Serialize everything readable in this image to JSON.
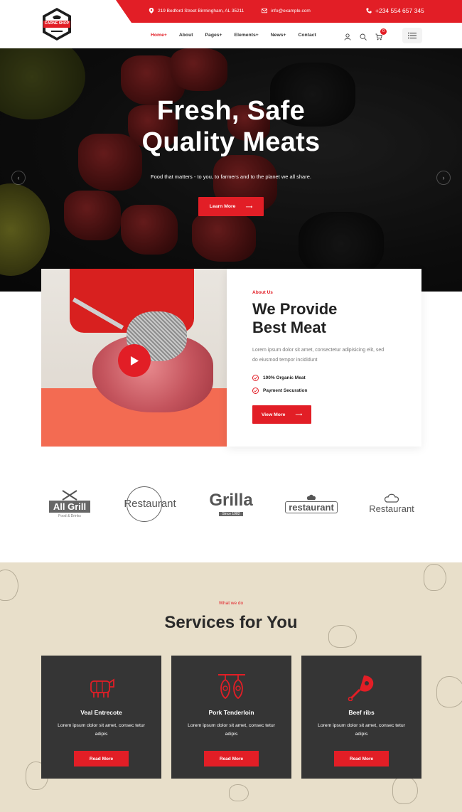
{
  "brand": {
    "logo_text": "CARNE SHOP",
    "accent": "#e21e26"
  },
  "topbar": {
    "address": "219 Bedford Street Birmingham, AL 35211",
    "email": "info@example.com",
    "phone": "+234 554 657 345"
  },
  "nav": {
    "items": [
      "Home",
      "About",
      "Pages",
      "Elements",
      "News",
      "Contact"
    ],
    "active": "Home",
    "cart_count": "0"
  },
  "hero": {
    "title_line1": "Fresh, Safe",
    "title_line2": "Quality Meats",
    "subtitle": "Food that matters - to you, to farmers and to the planet we all share.",
    "button": "Learn More"
  },
  "about": {
    "tag": "About Us",
    "title_line1": "We Provide",
    "title_line2": "Best Meat",
    "text": "Lorem ipsum dolor sit amet, consectetur adipisicing elit, sed do eiusmod tempor incididunt",
    "features": [
      "100% Organic Meat",
      "Payment Securation"
    ],
    "button": "View More"
  },
  "brands": [
    {
      "name": "All Grill",
      "sub": "Food & Drinks"
    },
    {
      "name": "Restaurant",
      "sub": ""
    },
    {
      "name": "Grilla",
      "sub": "Since 1982"
    },
    {
      "name": "restaurant",
      "sub": ""
    },
    {
      "name": "Restaurant",
      "sub": ""
    }
  ],
  "services": {
    "tag": "What we do",
    "title": "Services for You",
    "cards": [
      {
        "name": "Veal Entrecote",
        "text": "Lorem ipsum dolor sit amet, consec tetur adipis",
        "button": "Read More",
        "icon": "veal-icon"
      },
      {
        "name": "Pork Tenderloin",
        "text": "Lorem ipsum dolor sit amet, consec tetur adipis",
        "button": "Read More",
        "icon": "pork-icon"
      },
      {
        "name": "Beef ribs",
        "text": "Lorem ipsum dolor sit amet, consec tetur adipis",
        "button": "Read More",
        "icon": "beef-icon"
      }
    ]
  }
}
